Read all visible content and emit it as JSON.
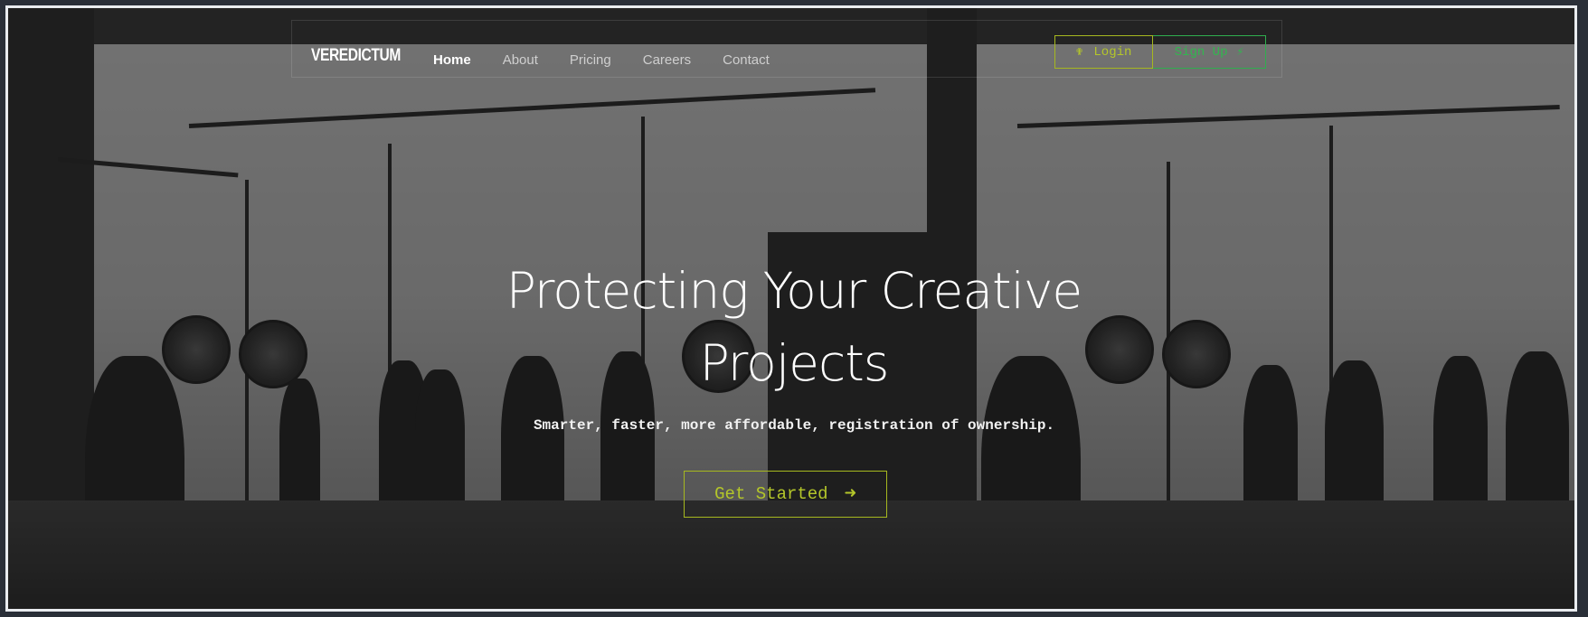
{
  "brand": {
    "logo": "VEREDICTUM"
  },
  "nav": {
    "links": [
      {
        "label": "Home",
        "active": true
      },
      {
        "label": "About",
        "active": false
      },
      {
        "label": "Pricing",
        "active": false
      },
      {
        "label": "Careers",
        "active": false
      },
      {
        "label": "Contact",
        "active": false
      }
    ]
  },
  "auth": {
    "login_label": "Login",
    "login_icon": "person-icon",
    "signup_label": "Sign Up",
    "signup_icon": "bolt-icon"
  },
  "hero": {
    "title_line1": "Protecting Your Creative",
    "title_line2": "Projects",
    "subtitle": "Smarter, faster, more affordable, registration of ownership.",
    "cta_label": "Get Started",
    "cta_icon": "arrow-right-icon"
  },
  "colors": {
    "accent_lime": "#b4c62a",
    "accent_green": "#32b64f",
    "text": "#ffffff"
  }
}
